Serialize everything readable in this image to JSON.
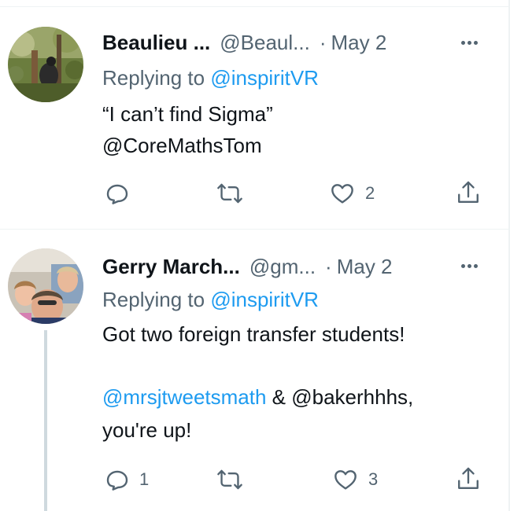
{
  "tweets": [
    {
      "name": "Beaulieu ...",
      "handle": "@Beaul...",
      "dot": "·",
      "date": "May 2",
      "replying_prefix": "Replying to ",
      "replying_to": "@inspiritVR",
      "text_line1": "“I can’t find Sigma”",
      "mention_line": "@CoreMathsTom",
      "reply_count": "",
      "retweet_count": "",
      "like_count": "2"
    },
    {
      "name": "Gerry March...",
      "handle": "@gm...",
      "dot": "·",
      "date": "May 2",
      "replying_prefix": "Replying to ",
      "replying_to": "@inspiritVR",
      "text_line1": "Got two foreign transfer students!",
      "mention": "@mrsjtweetsmath",
      "text_rest": " & @bakerhhhs,",
      "text_line3": "you're up!",
      "reply_count": "1",
      "retweet_count": "",
      "like_count": "3"
    }
  ],
  "colors": {
    "link": "#1d9bf0",
    "secondary": "#536471",
    "text": "#0f1419",
    "divider": "#eff3f4",
    "thread_line": "#cfd9de"
  },
  "icons": [
    "more-icon",
    "reply-icon",
    "retweet-icon",
    "like-icon",
    "share-icon"
  ]
}
